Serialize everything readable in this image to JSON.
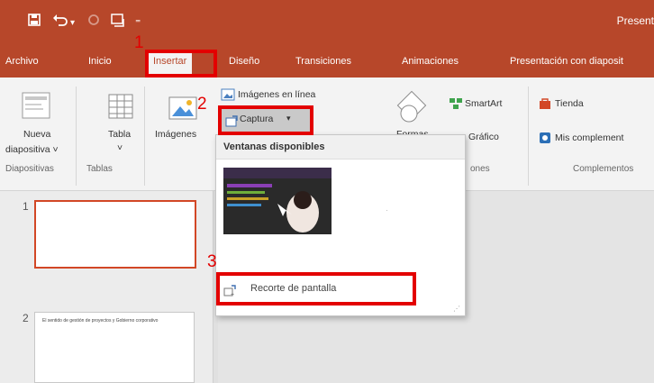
{
  "window": {
    "title": "Present"
  },
  "quick_access": {
    "save_icon": "save-icon",
    "undo_icon": "undo-icon",
    "redo_icon": "redo-icon",
    "customize_icon": "customize-icon"
  },
  "tabs": [
    {
      "label": "Archivo",
      "active": false
    },
    {
      "label": "Inicio",
      "active": false
    },
    {
      "label": "Insertar",
      "active": true
    },
    {
      "label": "Diseño",
      "active": false
    },
    {
      "label": "Transiciones",
      "active": false
    },
    {
      "label": "Animaciones",
      "active": false
    },
    {
      "label": "Presentación con diaposit",
      "active": false
    }
  ],
  "ribbon": {
    "new_slide_line1": "Nueva",
    "new_slide_line2": "diapositiva ˅",
    "table_label": "Tabla",
    "table_arrow": "˅",
    "images_label": "Imágenes",
    "online_images": "Imágenes en línea",
    "capture": "Captura",
    "shapes_partial": "Formas",
    "smartart": "SmartArt",
    "chart": "Gráfico",
    "store": "Tienda",
    "my_addins": "Mis complement",
    "groups": {
      "slides": "Diapositivas",
      "tables": "Tablas",
      "illustrations_partial": "ones",
      "addins": "Complementos"
    }
  },
  "dropdown": {
    "header": "Ventanas disponibles",
    "screen_clipping": "Recorte de pantalla"
  },
  "slides": [
    {
      "number": "1",
      "text": ""
    },
    {
      "number": "2",
      "text": "El sentido de gestión de proyectos y Gobierno corporativo"
    }
  ],
  "annotations": [
    "1",
    "2",
    "3"
  ],
  "colors": {
    "accent": "#b7472a",
    "highlight": "#e30000",
    "ribbon_bg": "#f3f3f3"
  }
}
